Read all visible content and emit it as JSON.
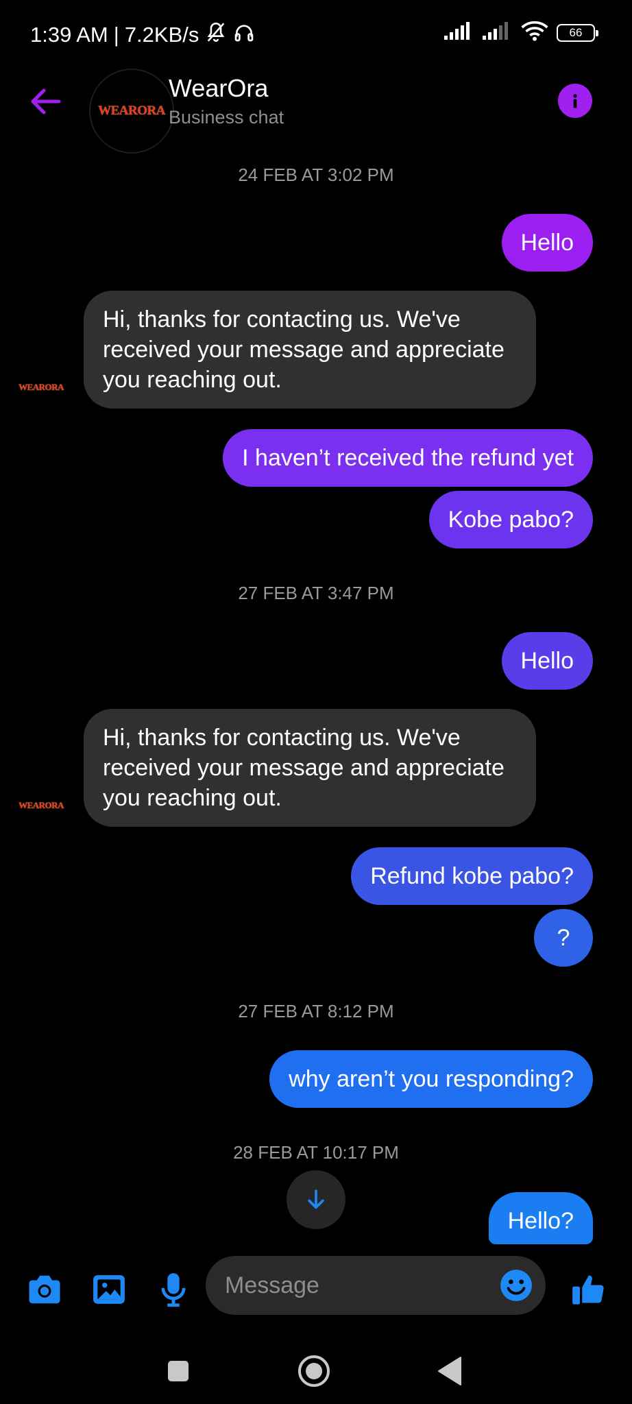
{
  "status_bar": {
    "time": "1:39 AM",
    "separator": "|",
    "speed": "7.2KB/s",
    "battery": "66"
  },
  "header": {
    "contact_name": "WearOra",
    "subtitle": "Business chat",
    "avatar_logo": "WEARORA",
    "back_icon": "back-arrow-icon",
    "info_icon": "info-icon",
    "accent_color": "#a020f0"
  },
  "messages": {
    "ts1": "24 FEB AT 3:02 PM",
    "m1": "Hello",
    "m2": "Hi, thanks for contacting us. We've received your message and appreciate you reaching out.",
    "m3": "I haven’t received the refund yet",
    "m4": "Kobe pabo?",
    "ts2": "27 FEB AT 3:47 PM",
    "m5": "Hello",
    "m6": "Hi, thanks for contacting us. We've received your message and appreciate you reaching out.",
    "m7": "Refund kobe pabo?",
    "m8": "?",
    "ts3": "27 FEB AT 8:12 PM",
    "m9": "why aren’t you responding?",
    "ts4": "28 FEB AT 10:17 PM",
    "m10": "Hello?",
    "sender_logo": "WEARORA"
  },
  "bubble_colors": {
    "m1": "#9b1ff0",
    "m3": "#7b2ff0",
    "m4": "#6c34ee",
    "m5": "#5a3ce8",
    "m7": "#3a55e3",
    "m8": "#2f62e6",
    "m9": "#1f6ff0",
    "m10": "#1a7ef2",
    "incoming": "#303030"
  },
  "composer": {
    "placeholder": "Message",
    "icons": [
      "camera-icon",
      "gallery-icon",
      "microphone-icon",
      "emoji-icon",
      "thumbs-up-icon"
    ],
    "icon_color": "#1e88f5"
  },
  "nav_bar": {
    "icons": [
      "recent-apps-icon",
      "home-icon",
      "back-icon"
    ]
  }
}
